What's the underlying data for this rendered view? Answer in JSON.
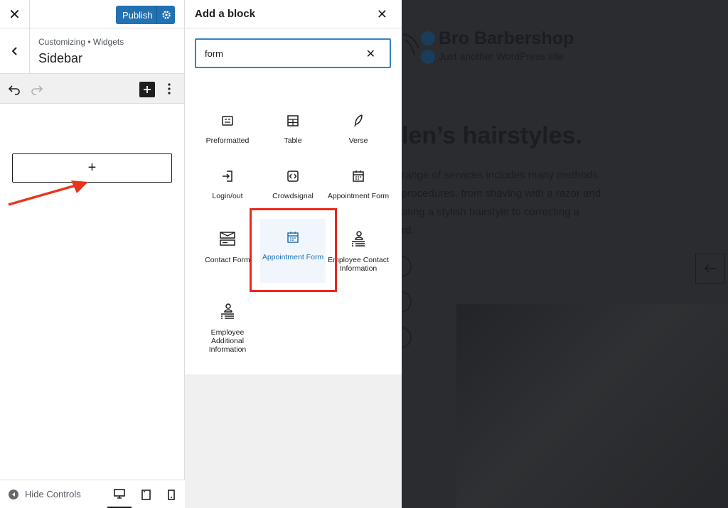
{
  "customizer": {
    "publish_label": "Publish",
    "breadcrumb": "Customizing • Widgets",
    "section_title": "Sidebar",
    "hide_controls_label": "Hide Controls",
    "close_glyph": "✕",
    "add_glyph": "+"
  },
  "inserter": {
    "title": "Add a block",
    "close_glyph": "✕",
    "search_value": "form",
    "clear_glyph": "✕",
    "blocks": [
      {
        "label": "Preformatted",
        "icon": "preformatted-icon"
      },
      {
        "label": "Table",
        "icon": "table-icon"
      },
      {
        "label": "Verse",
        "icon": "feather-icon"
      },
      {
        "label": "Login/out",
        "icon": "login-icon"
      },
      {
        "label": "Crowdsignal",
        "icon": "crowdsignal-icon"
      },
      {
        "label": "Appointment Form",
        "icon": "calendar-icon"
      },
      {
        "label": "Contact Form",
        "icon": "contact-form-icon"
      },
      {
        "label": "Appointment Form",
        "icon": "calendar-icon",
        "selected": true
      },
      {
        "label": "Employee Contact Information",
        "icon": "employee-icon"
      },
      {
        "label": "Employee Additional Information",
        "icon": "employee-icon"
      }
    ]
  },
  "preview": {
    "site_title": "Bro Barbershop",
    "site_tagline": "Just another WordPress site",
    "heading": "len’s hairstyles.",
    "paragraph_lines": [
      "range of services includes many methods",
      "procedures: from shaving with a razor and",
      "ating a stylish hairstyle to correcting a",
      "rd."
    ]
  },
  "colors": {
    "accent": "#2271b1",
    "highlight": "#e8291c",
    "overlay": "#2a2c30"
  }
}
